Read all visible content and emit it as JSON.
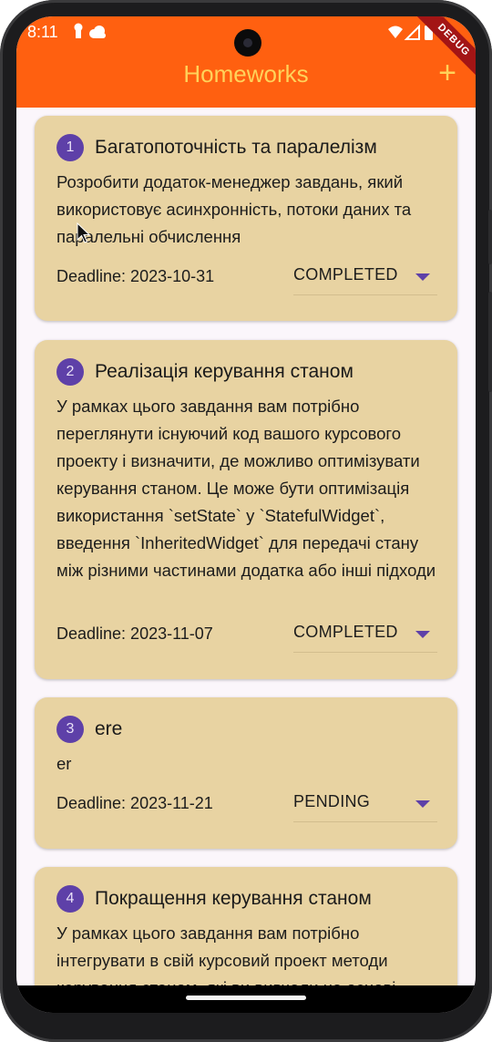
{
  "status_bar": {
    "time": "8:11"
  },
  "debug_banner": "DEBUG",
  "app_bar": {
    "title": "Homeworks",
    "add_icon": "+"
  },
  "homeworks": [
    {
      "number": "1",
      "title": "Багатопоточність та паралелізм",
      "description": "Розробити додаток-менеджер завдань, який використовує асинхронність, потоки даних та паралельні обчислення",
      "deadline": "Deadline: 2023-10-31",
      "status": "COMPLETED"
    },
    {
      "number": "2",
      "title": "Реалізація керування станом",
      "description": "У рамках цього завдання вам потрібно переглянути існуючий код вашого курсового проекту і визначити, де можливо оптимізувати керування станом. Це може бути оптимізація використання `setState` у `StatefulWidget`, введення `InheritedWidget` для передачі стану між різними частинами додатка або інші підходи",
      "deadline": "Deadline: 2023-11-07",
      "status": "COMPLETED"
    },
    {
      "number": "3",
      "title": "ere",
      "description": "er",
      "deadline": "Deadline: 2023-11-21",
      "status": "PENDING"
    },
    {
      "number": "4",
      "title": "Покращення керування станом",
      "description": "У рамках цього завдання вам потрібно інтегрувати в свій курсовий проект методи керування станом, які ви вивчали на основі"
    }
  ],
  "colors": {
    "app_bar": "#ff6010",
    "title_text": "#ffd25a",
    "card_bg": "#e8d3a2",
    "accent": "#5e40a8",
    "screen_bg": "#fbf6fb"
  }
}
